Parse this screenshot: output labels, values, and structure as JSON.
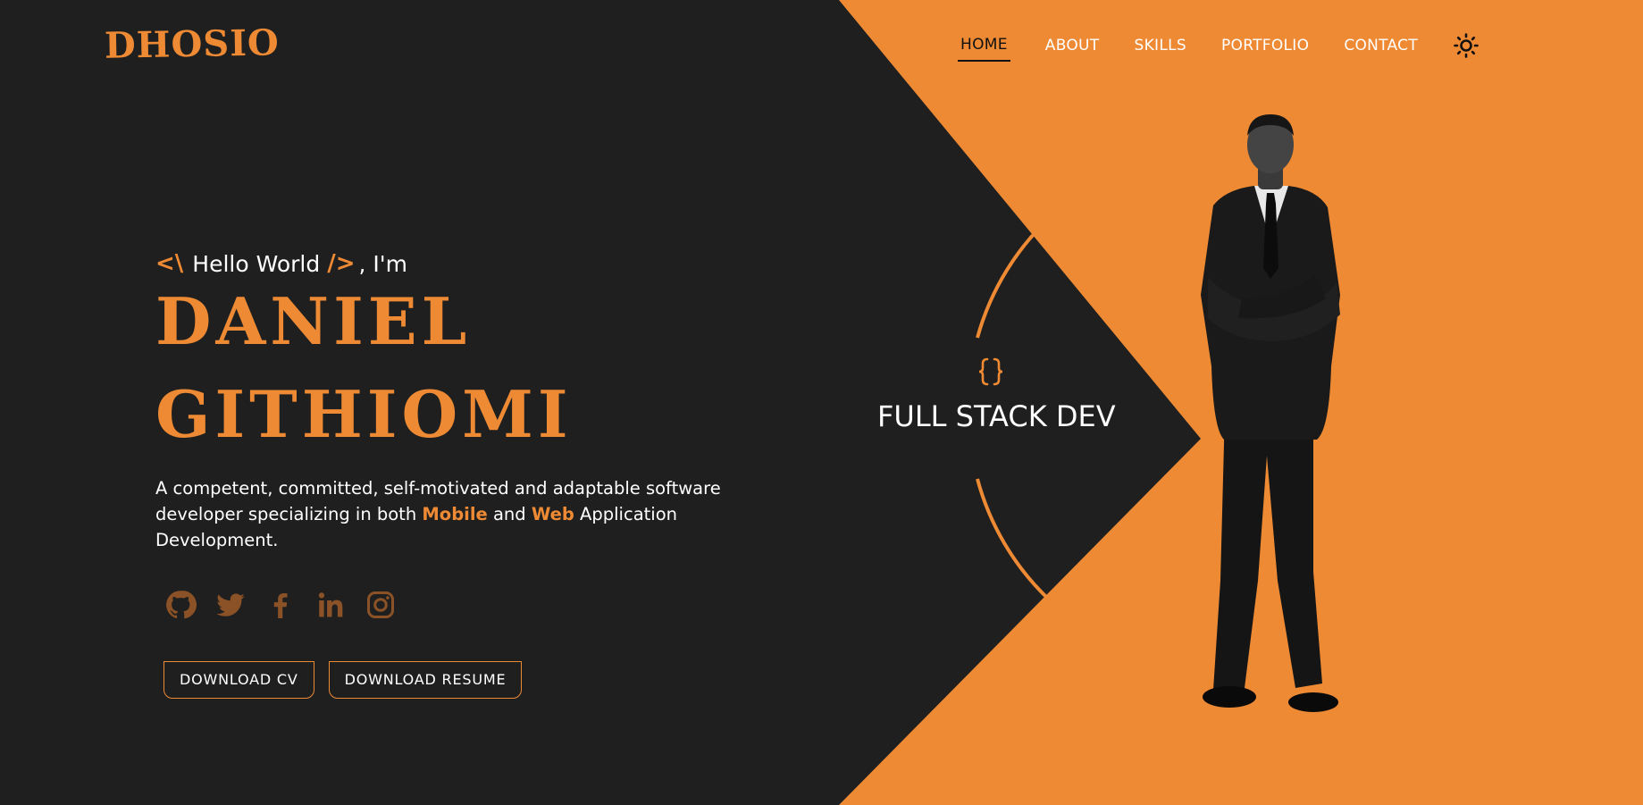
{
  "brand": {
    "logo": "DHOSIO"
  },
  "nav": {
    "items": [
      {
        "label": "HOME"
      },
      {
        "label": "ABOUT"
      },
      {
        "label": "SKILLS"
      },
      {
        "label": "PORTFOLIO"
      },
      {
        "label": "CONTACT"
      }
    ],
    "active": "HOME",
    "theme_toggle_icon": "sun-icon"
  },
  "hero": {
    "tag_open": "<\\",
    "greeting": "Hello World",
    "tag_close": "/>",
    "intro_suffix": ", I'm",
    "first_name": "DANIEL",
    "last_name": "GITHIOMI",
    "description_part1": "A competent, committed, self-motivated and adaptable software developer specializing in both",
    "highlight1": "Mobile",
    "description_part2": "and",
    "highlight2": "Web",
    "description_part3": "Application Development."
  },
  "socials": [
    {
      "icon": "github-icon"
    },
    {
      "icon": "twitter-icon"
    },
    {
      "icon": "facebook-icon"
    },
    {
      "icon": "linkedin-icon"
    },
    {
      "icon": "instagram-icon"
    }
  ],
  "buttons": {
    "cv": "DOWNLOAD CV",
    "resume": "DOWNLOAD RESUME"
  },
  "role": {
    "icon": "code-braces-icon",
    "title": "FULL STACK DEV"
  },
  "colors": {
    "accent": "#ee8a34",
    "background": "#1f1f1f",
    "text": "#ffffff"
  }
}
